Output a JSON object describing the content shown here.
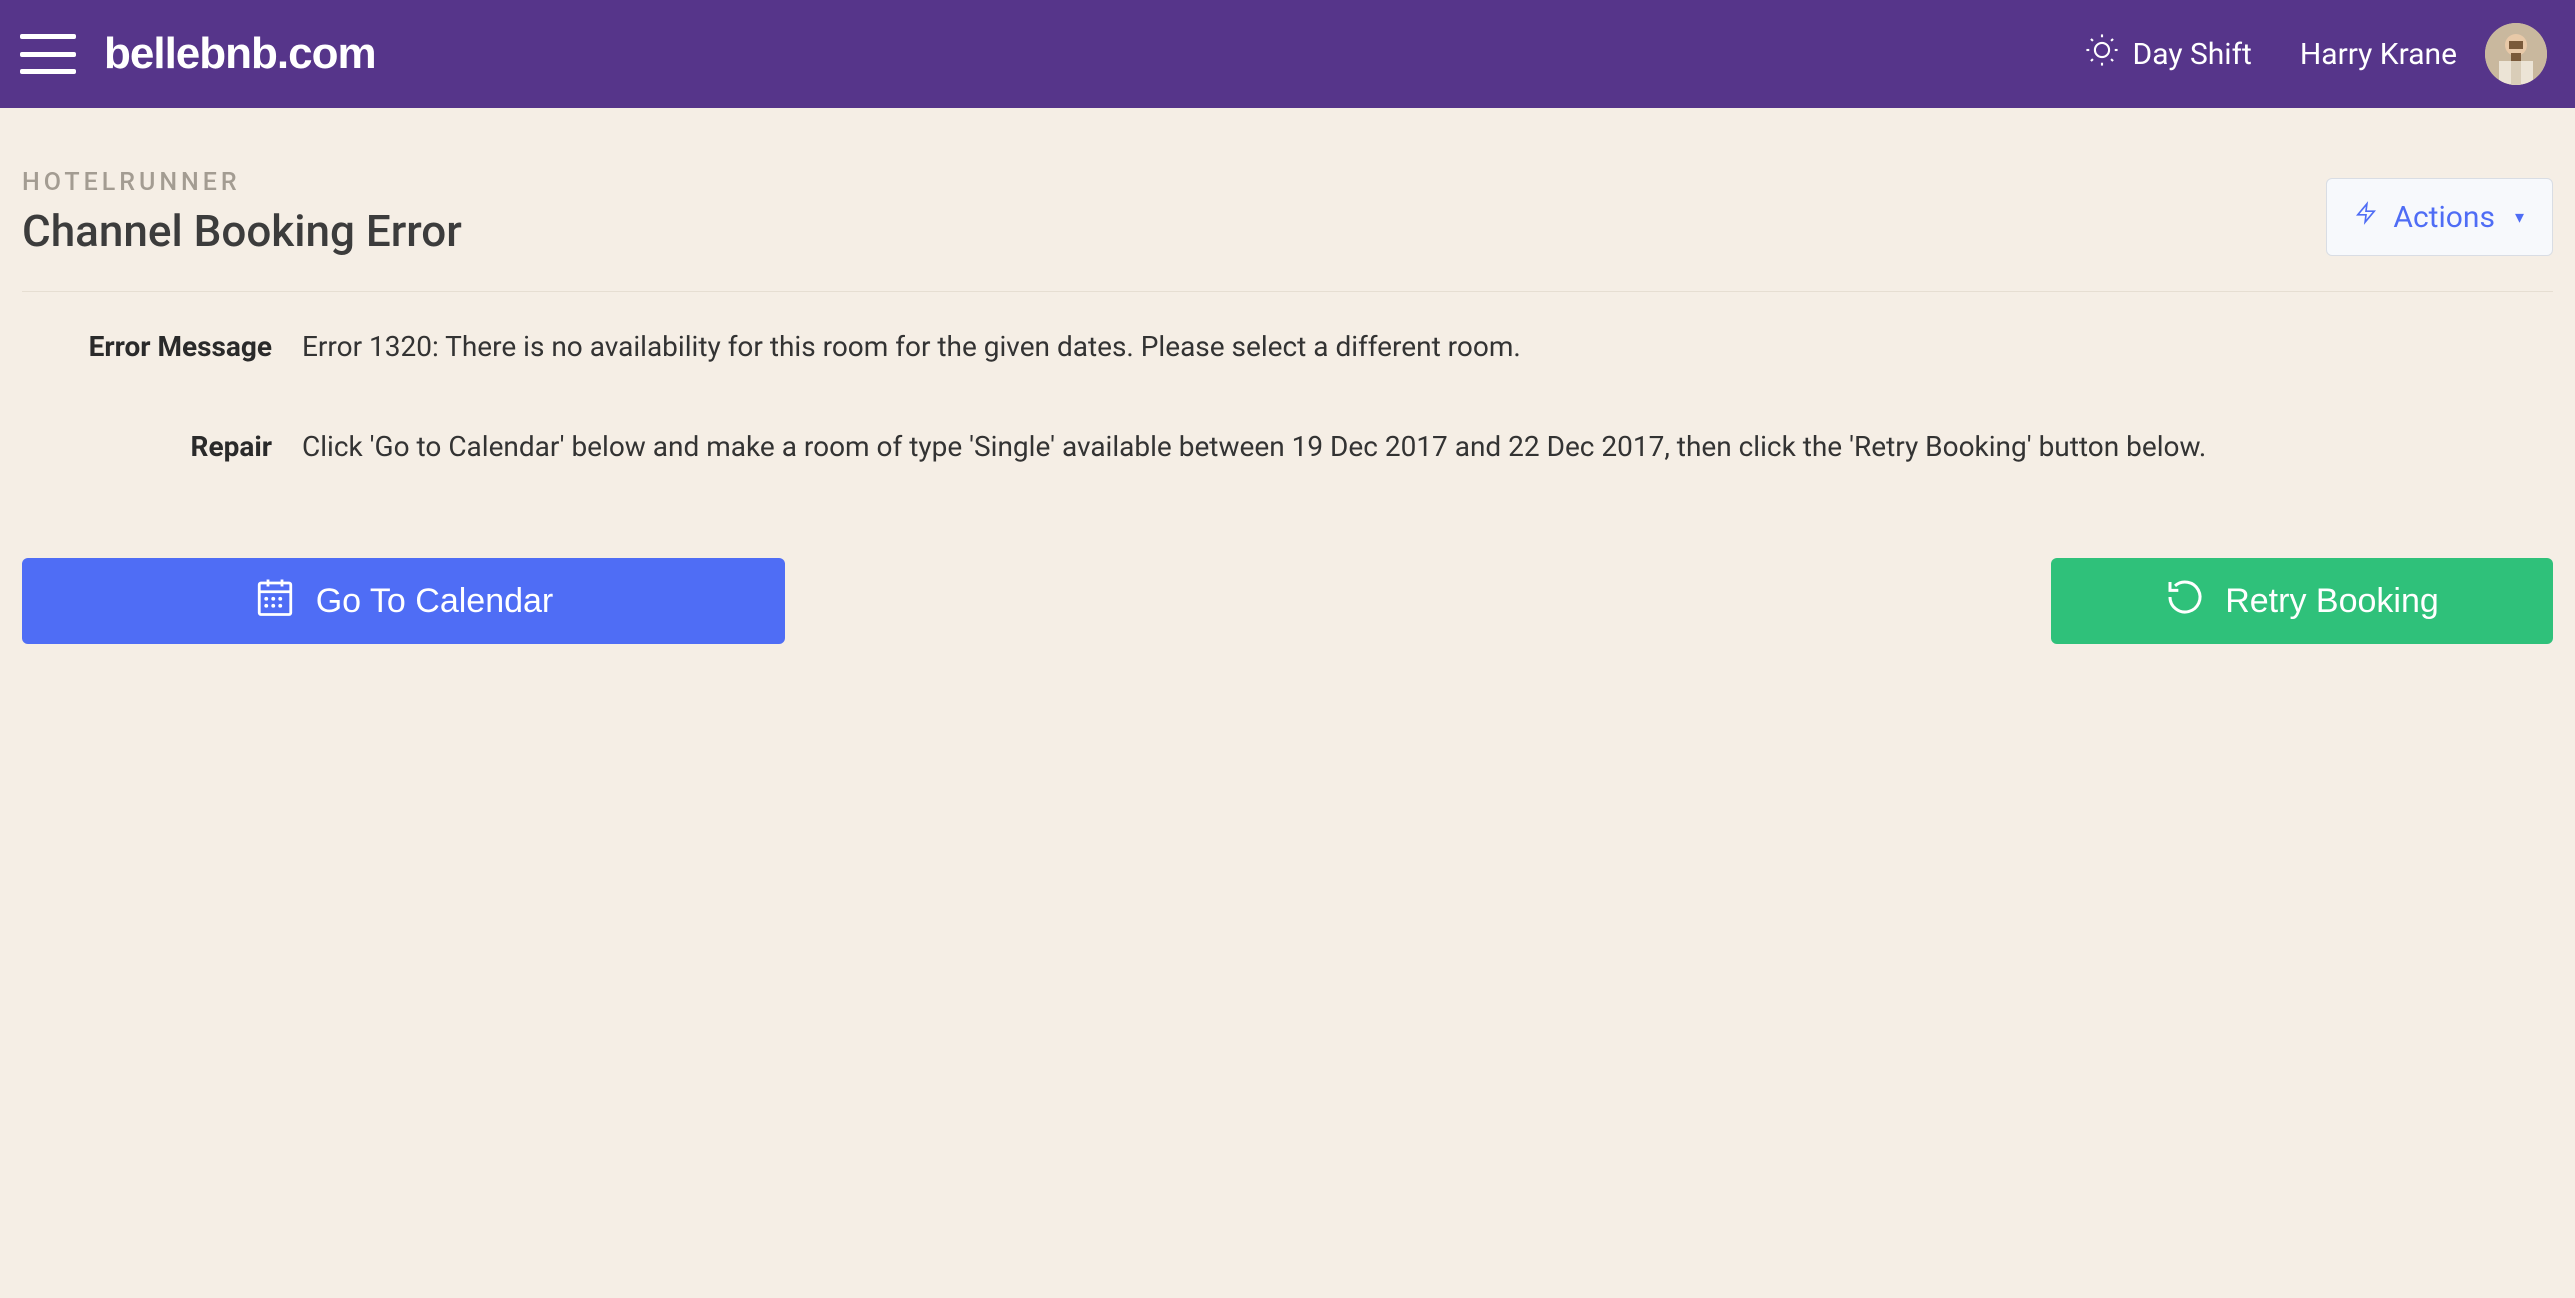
{
  "header": {
    "brand": "bellebnb.com",
    "shift_label": "Day Shift",
    "user_name": "Harry Krane"
  },
  "page": {
    "breadcrumb": "HOTELRUNNER",
    "title": "Channel Booking Error",
    "actions_label": "Actions"
  },
  "details": {
    "error_label": "Error Message",
    "error_text": "Error 1320: There is no availability for this room for the given dates. Please select a different room.",
    "repair_label": "Repair",
    "repair_text": "Click 'Go to Calendar' below and make a room of type 'Single' available between 19 Dec 2017 and 22 Dec 2017, then click the 'Retry Booking' button below."
  },
  "buttons": {
    "go_to_calendar": "Go To Calendar",
    "retry_booking": "Retry Booking"
  }
}
